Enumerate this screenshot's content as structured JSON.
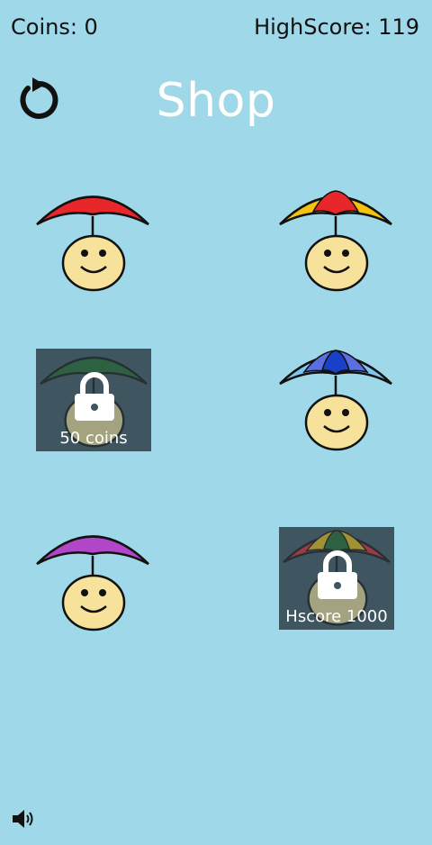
{
  "hud": {
    "coins": "Coins: 0",
    "highscore": "HighScore: 119"
  },
  "title": "Shop",
  "items": [
    {
      "colors": [
        "#e8272a"
      ],
      "locked": false
    },
    {
      "colors": [
        "#f4c20f",
        "#e8272a"
      ],
      "locked": false
    },
    {
      "colors": [
        "#1f6b2a"
      ],
      "locked": true,
      "label": "50 coins"
    },
    {
      "colors": [
        "#7ec8f0",
        "#1a3fc9",
        "#5b6fe0"
      ],
      "locked": false
    },
    {
      "colors": [
        "#b146c8"
      ],
      "locked": false
    },
    {
      "colors": [
        "#e8272a",
        "#f4c20f",
        "#1f6b2a"
      ],
      "locked": true,
      "label": "Hscore 1000"
    }
  ],
  "icons": {
    "back": "restart-arrow-icon",
    "sound": "speaker-icon",
    "lock": "padlock-icon"
  },
  "face_color": "#f6e29a",
  "background": "#9fd8e8"
}
